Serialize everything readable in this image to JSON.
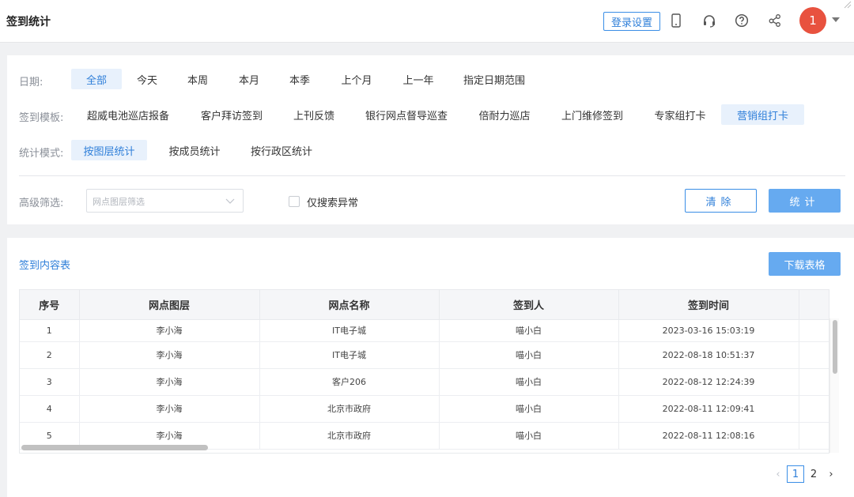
{
  "header": {
    "title": "签到统计",
    "login_settings": "登录设置",
    "avatar_text": "1"
  },
  "filters": {
    "date_label": "日期:",
    "date_options": [
      "全部",
      "今天",
      "本周",
      "本月",
      "本季",
      "上个月",
      "上一年",
      "指定日期范围"
    ],
    "date_active": "全部",
    "template_label": "签到模板:",
    "template_options": [
      "超威电池巡店报备",
      "客户拜访签到",
      "上刊反馈",
      "银行网点督导巡查",
      "倍耐力巡店",
      "上门维修签到",
      "专家组打卡",
      "营销组打卡"
    ],
    "template_active": "营销组打卡",
    "mode_label": "统计模式:",
    "mode_options": [
      "按图层统计",
      "按成员统计",
      "按行政区统计"
    ],
    "mode_active": "按图层统计",
    "advanced_label": "高级筛选:",
    "layer_select_placeholder": "网点图层筛选",
    "abnormal_only_label": "仅搜索异常",
    "clear_label": "清除",
    "stat_label": "统计"
  },
  "table_section": {
    "title": "签到内容表",
    "download_label": "下载表格",
    "columns": [
      "序号",
      "网点图层",
      "网点名称",
      "签到人",
      "签到时间",
      ""
    ],
    "rows": [
      [
        "1",
        "李小海",
        "IT电子城",
        "喵小白",
        "2023-03-16 15:03:19"
      ],
      [
        "2",
        "李小海",
        "IT电子城",
        "喵小白",
        "2022-08-18 10:51:37"
      ],
      [
        "3",
        "李小海",
        "客户206",
        "喵小白",
        "2022-08-12 12:24:39"
      ],
      [
        "4",
        "李小海",
        "北京市政府",
        "喵小白",
        "2022-08-11 12:09:41"
      ],
      [
        "5",
        "李小海",
        "北京市政府",
        "喵小白",
        "2022-08-11 12:08:16"
      ]
    ]
  },
  "pagination": {
    "pages": [
      "1",
      "2"
    ],
    "current": "1",
    "prev": "‹",
    "next": "›"
  },
  "colors": {
    "accent": "#2f7fd9",
    "primary_button": "#66aaf0",
    "avatar": "#e8523f"
  }
}
